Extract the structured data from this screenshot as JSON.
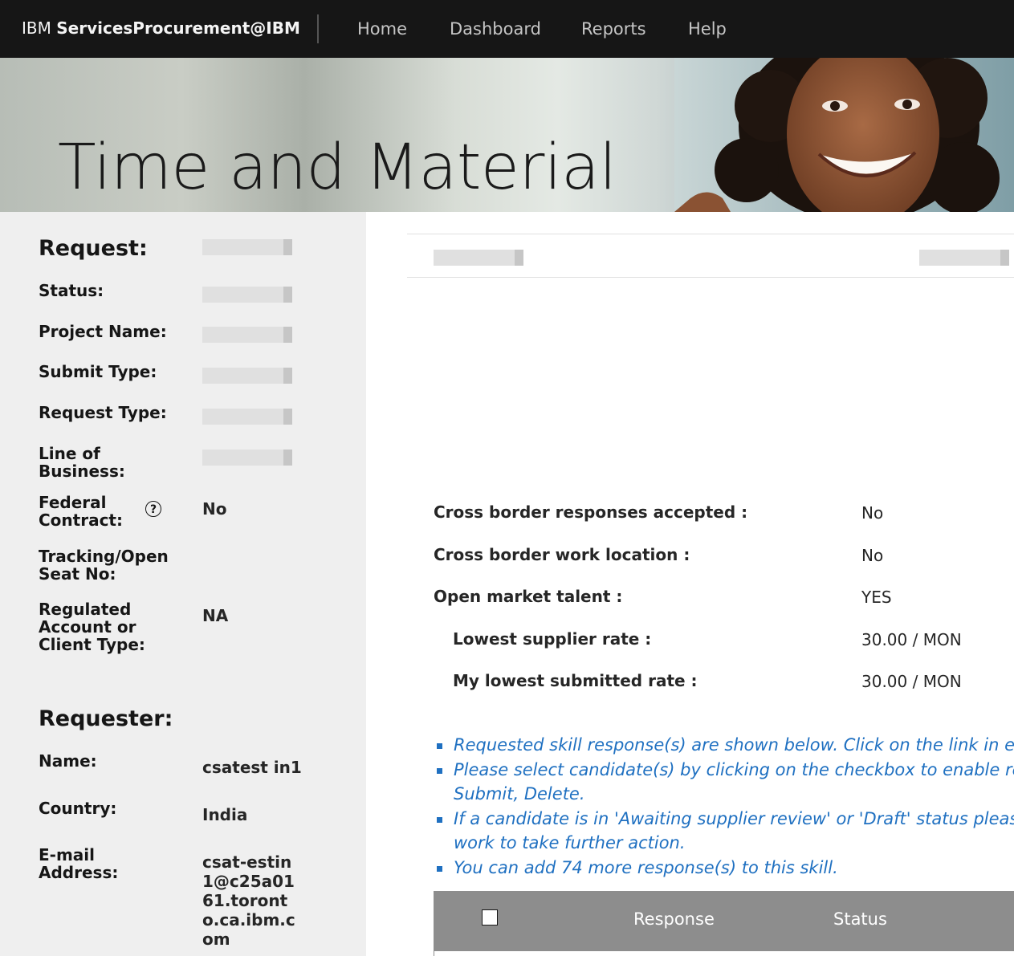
{
  "header": {
    "brand_prefix": "IBM",
    "brand_name": "ServicesProcurement@IBM",
    "nav": [
      "Home",
      "Dashboard",
      "Reports",
      "Help"
    ]
  },
  "hero": {
    "title": "Time and Material"
  },
  "sidebar": {
    "request_heading": "Request:",
    "status_label": "Status:",
    "project_name_label": "Project Name:",
    "submit_type_label": "Submit Type:",
    "request_type_label": "Request Type:",
    "line_of_business_label": "Line of Business:",
    "federal_contract_label": "Federal Contract:",
    "federal_contract_value": "No",
    "tracking_label": "Tracking/Open Seat No:",
    "regulated_label": "Regulated Account or Client Type:",
    "regulated_value": "NA",
    "requester_heading": "Requester:",
    "name_label": "Name:",
    "name_value": "csatest in1",
    "country_label": "Country:",
    "country_value": "India",
    "email_label": "E-mail Address:",
    "email_value": "csat-estin1@c25a0161.toronto.ca.ibm.com"
  },
  "details": {
    "cross_border_responses_label": "Cross border responses accepted :",
    "cross_border_responses_value": "No",
    "cross_border_work_label": "Cross border work location :",
    "cross_border_work_value": "No",
    "open_market_label": "Open market talent :",
    "open_market_value": "YES",
    "lowest_supplier_label": "Lowest supplier rate :",
    "lowest_supplier_value": "30.00 / MON",
    "my_lowest_label": "My lowest submitted rate :",
    "my_lowest_value": "30.00 / MON"
  },
  "notes": [
    "Requested skill response(s) are shown below. Click on the link in each",
    "Please select candidate(s) by clicking on the checkbox to enable relev",
    "Submit, Delete.",
    "If a candidate is in 'Awaiting supplier review' or 'Draft' status please cli",
    "work to take further action.",
    "You can add 74 more response(s) to this skill."
  ],
  "table": {
    "col_response": "Response",
    "col_status": "Status"
  },
  "colors": {
    "accent": "#1f70c1",
    "topbar": "#161616",
    "table_header": "#8d8d8d",
    "sidebar": "#efefef"
  }
}
